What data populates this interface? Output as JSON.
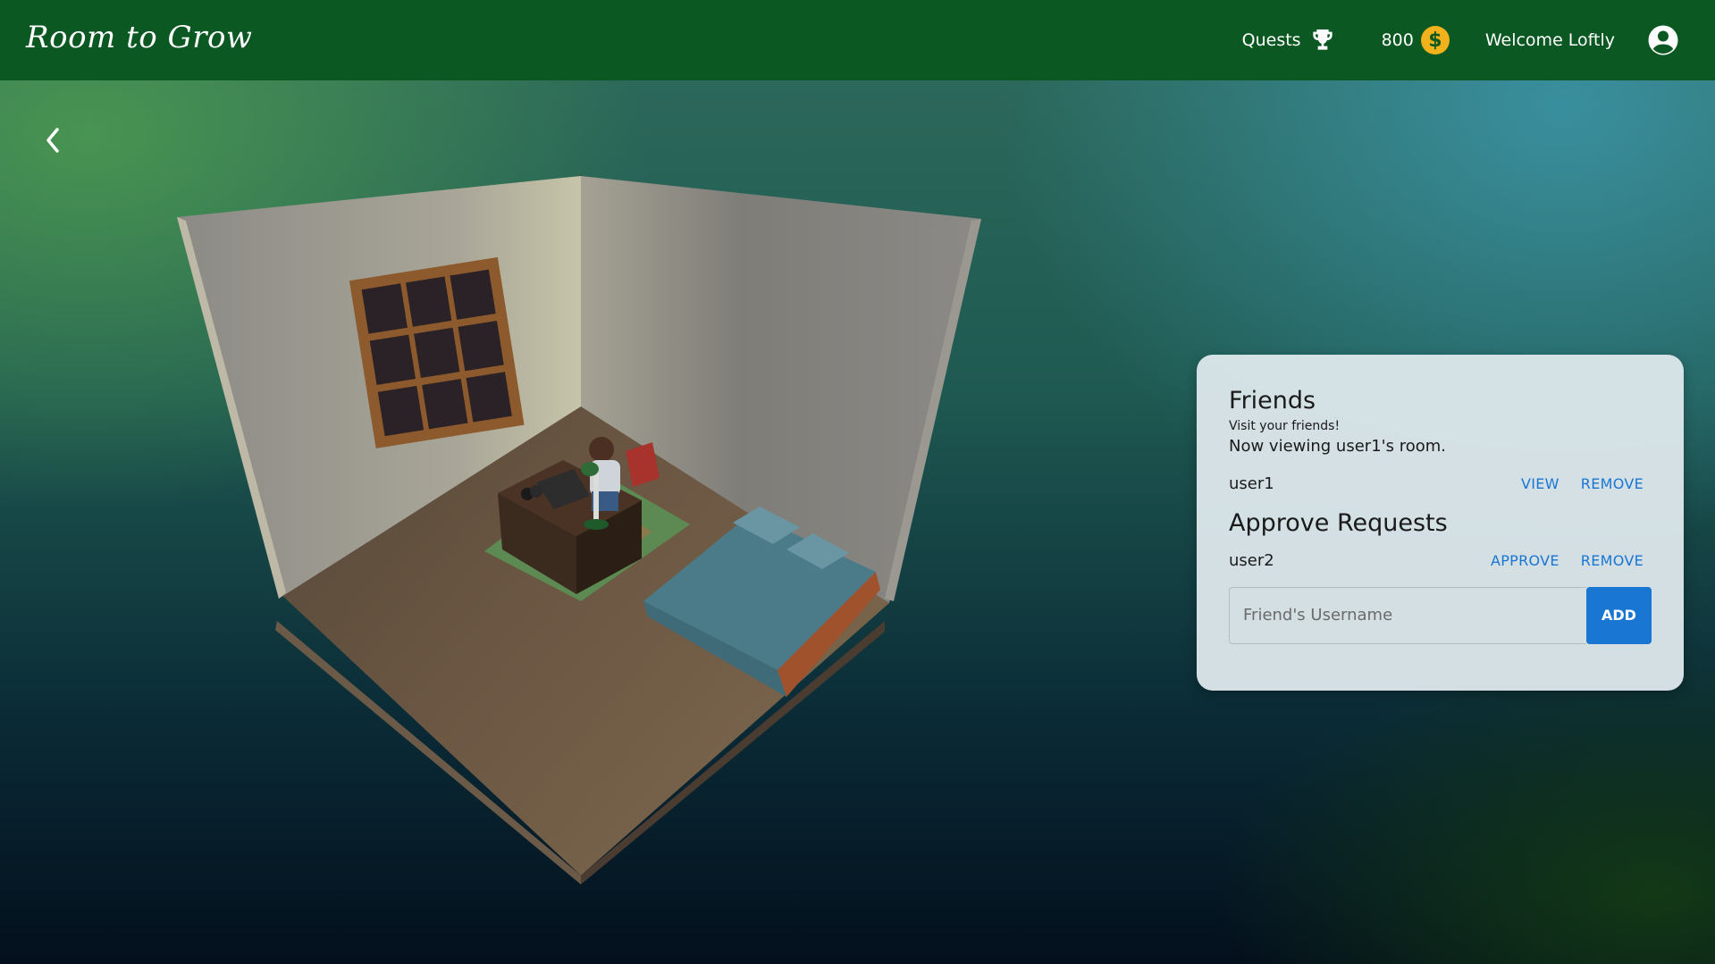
{
  "header": {
    "app_title": "Room to Grow",
    "quests_label": "Quests",
    "coin_count": "800",
    "coin_symbol": "$",
    "welcome_text": "Welcome Loftly"
  },
  "friends_panel": {
    "title": "Friends",
    "subtitle": "Visit your friends!",
    "viewing_status": "Now viewing user1's room.",
    "friends": [
      {
        "username": "user1",
        "view_label": "VIEW",
        "remove_label": "REMOVE"
      }
    ],
    "approve_title": "Approve Requests",
    "requests": [
      {
        "username": "user2",
        "approve_label": "APPROVE",
        "remove_label": "REMOVE"
      }
    ],
    "add_input_placeholder": "Friend's Username",
    "add_button_label": "ADD"
  },
  "colors": {
    "topbar": "#0b5822",
    "accent": "#1976d2",
    "coin": "#f1b21b"
  },
  "icons": [
    "trophy-icon",
    "coin-icon",
    "account-circle-icon",
    "chevron-left-icon"
  ]
}
